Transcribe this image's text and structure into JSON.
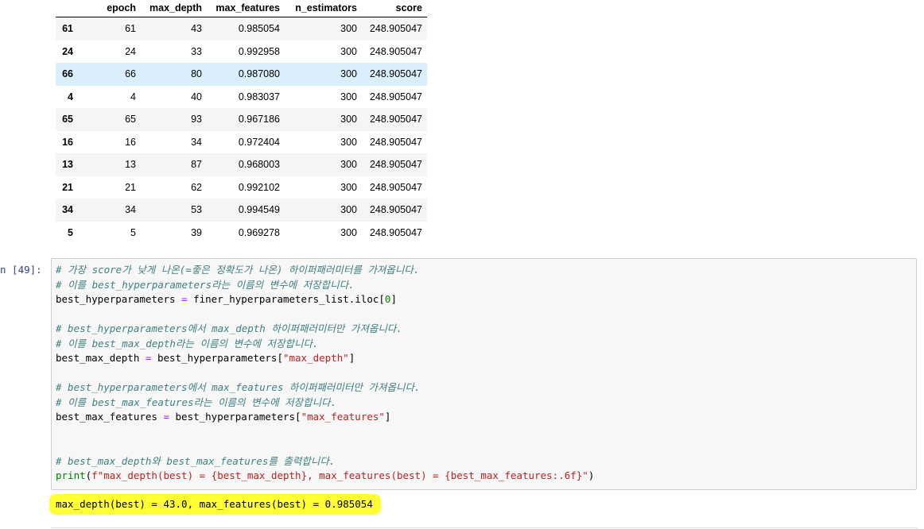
{
  "table": {
    "columns": [
      "",
      "epoch",
      "max_depth",
      "max_features",
      "n_estimators",
      "score"
    ],
    "rows": [
      {
        "index": "61",
        "epoch": "61",
        "max_depth": "43",
        "max_features": "0.985054",
        "n_estimators": "300",
        "score": "248.905047"
      },
      {
        "index": "24",
        "epoch": "24",
        "max_depth": "33",
        "max_features": "0.992958",
        "n_estimators": "300",
        "score": "248.905047"
      },
      {
        "index": "66",
        "epoch": "66",
        "max_depth": "80",
        "max_features": "0.987080",
        "n_estimators": "300",
        "score": "248.905047"
      },
      {
        "index": "4",
        "epoch": "4",
        "max_depth": "40",
        "max_features": "0.983037",
        "n_estimators": "300",
        "score": "248.905047"
      },
      {
        "index": "65",
        "epoch": "65",
        "max_depth": "93",
        "max_features": "0.967186",
        "n_estimators": "300",
        "score": "248.905047"
      },
      {
        "index": "16",
        "epoch": "16",
        "max_depth": "34",
        "max_features": "0.972404",
        "n_estimators": "300",
        "score": "248.905047"
      },
      {
        "index": "13",
        "epoch": "13",
        "max_depth": "87",
        "max_features": "0.968003",
        "n_estimators": "300",
        "score": "248.905047"
      },
      {
        "index": "21",
        "epoch": "21",
        "max_depth": "62",
        "max_features": "0.992102",
        "n_estimators": "300",
        "score": "248.905047"
      },
      {
        "index": "34",
        "epoch": "34",
        "max_depth": "53",
        "max_features": "0.994549",
        "n_estimators": "300",
        "score": "248.905047"
      },
      {
        "index": "5",
        "epoch": "5",
        "max_depth": "39",
        "max_features": "0.969278",
        "n_estimators": "300",
        "score": "248.905047"
      }
    ],
    "highlighted_row_index": "66"
  },
  "cell": {
    "prompt": "n [49]:",
    "code": {
      "l1": "# 가장 score가 낮게 나온(=좋은 정확도가 나온) 하이퍼패러미터를 가져옵니다.",
      "l2": "# 이를 best_hyperparameters라는 이름의 변수에 저장합니다.",
      "l3a": "best_hyperparameters",
      "l3b": " = ",
      "l3c": "finer_hyperparameters_list.iloc[",
      "l3d": "0",
      "l3e": "]",
      "l5": "# best_hyperparameters에서 max_depth 하이퍼패러미터만 가져옵니다.",
      "l6": "# 이를 best_max_depth라는 이름의 변수에 저장합니다.",
      "l7a": "best_max_depth",
      "l7b": " = ",
      "l7c": "best_hyperparameters[",
      "l7d": "\"max_depth\"",
      "l7e": "]",
      "l9": "# best_hyperparameters에서 max_features 하이퍼패러미터만 가져옵니다.",
      "l10": "# 이를 best_max_features라는 이름의 변수에 저장합니다.",
      "l11a": "best_max_features",
      "l11b": " = ",
      "l11c": "best_hyperparameters[",
      "l11d": "\"max_features\"",
      "l11e": "]",
      "l14": "# best_max_depth와 best_max_features를 출력합니다.",
      "l15a": "print",
      "l15b": "(",
      "l15c": "f\"max_depth(best) = {best_max_depth}, max_features(best) = {best_max_features:.6f}\"",
      "l15d": ")"
    },
    "output": "max_depth(best) = 43.0, max_features(best) = 0.985054"
  }
}
